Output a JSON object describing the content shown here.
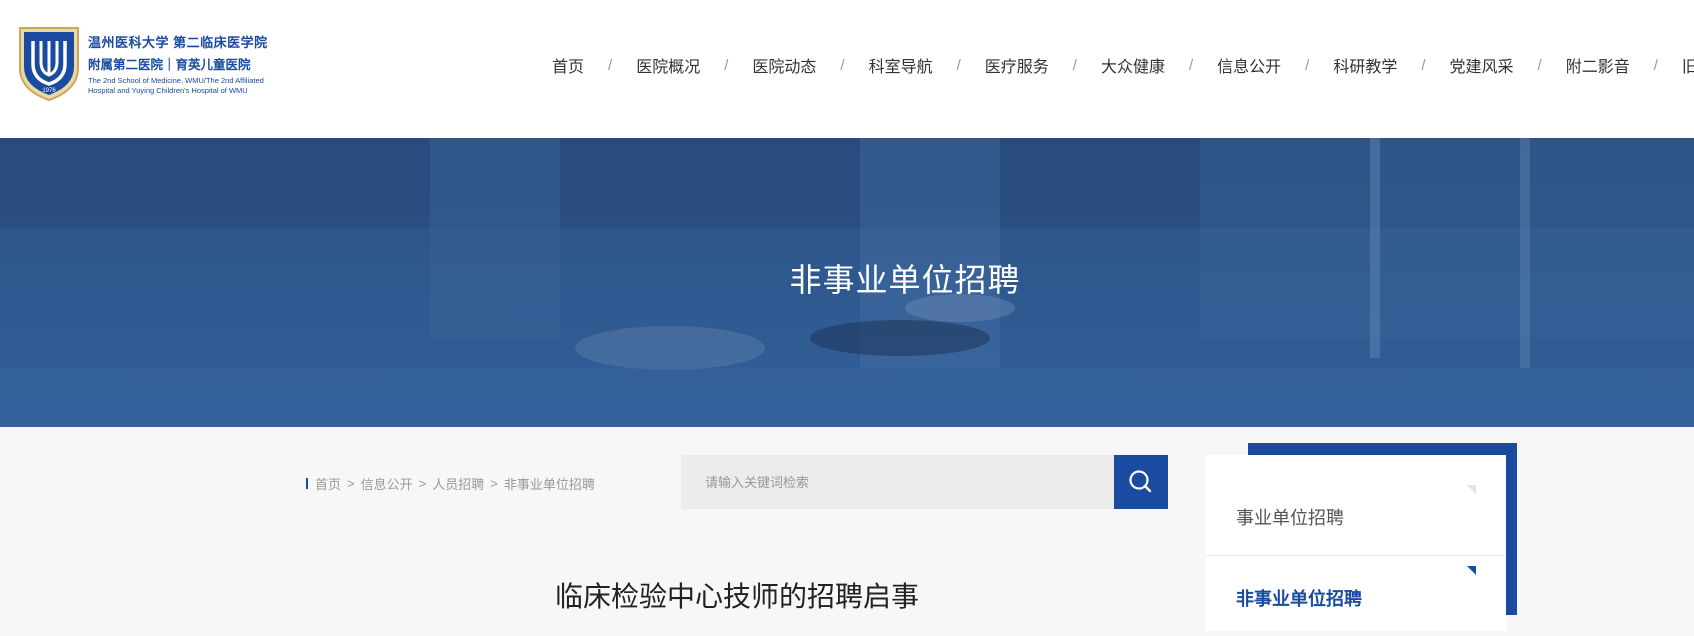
{
  "header": {
    "logo": {
      "name_cn_line1": "温州医科大学 第二临床医学院",
      "name_cn_line2": "附属第二医院｜育英儿童医院",
      "name_en_line1": "The 2nd School of Medicine, WMU/The 2nd Affiliated",
      "name_en_line2": "Hospital and Yuying Children's Hospital of WMU",
      "year": "1976",
      "icon": "hospital-emblem-icon"
    },
    "nav": [
      {
        "label": "首页"
      },
      {
        "label": "医院概况"
      },
      {
        "label": "医院动态"
      },
      {
        "label": "科室导航"
      },
      {
        "label": "医疗服务"
      },
      {
        "label": "大众健康"
      },
      {
        "label": "信息公开"
      },
      {
        "label": "科研教学"
      },
      {
        "label": "党建风采"
      },
      {
        "label": "附二影音"
      },
      {
        "label": "旧版入口"
      }
    ],
    "nav_separator": "/"
  },
  "banner": {
    "title": "非事业单位招聘"
  },
  "breadcrumb": {
    "items": [
      "首页",
      "信息公开",
      "人员招聘",
      "非事业单位招聘"
    ],
    "separator": ">"
  },
  "search": {
    "placeholder": "请输入关键词检索",
    "icon": "search-icon"
  },
  "article": {
    "title": "临床检验中心技师的招聘启事"
  },
  "sidebar": {
    "items": [
      {
        "label": "事业单位招聘",
        "active": false
      },
      {
        "label": "非事业单位招聘",
        "active": true
      }
    ]
  },
  "colors": {
    "brand": "#1a4ba0",
    "banner": "#2e588e",
    "page_bg": "#f7f7f7"
  }
}
